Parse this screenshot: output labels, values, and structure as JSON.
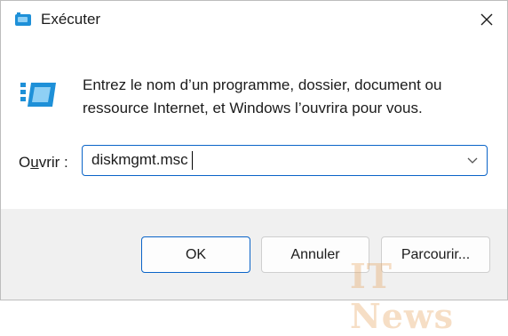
{
  "window": {
    "title": "Exécuter",
    "title_icon": "run-dialog-icon",
    "close_icon": "close-icon"
  },
  "content": {
    "message_line1": "Entrez le nom d’un programme, dossier, document ou",
    "message_line2": "ressource Internet, et Windows l’ouvrira pour vous.",
    "icon": "run-dialog-icon"
  },
  "open_field": {
    "label_prefix": "O",
    "label_underlined": "u",
    "label_suffix": "vrir :",
    "value": "diskmgmt.msc",
    "dropdown_icon": "chevron-down-icon"
  },
  "buttons": {
    "ok": "OK",
    "cancel": "Annuler",
    "browse": "Parcourir..."
  },
  "watermark": "IT News",
  "colors": {
    "accent": "#0a64c8",
    "icon_blue": "#1e90d8",
    "icon_light": "#8fd0f5",
    "footer_bg": "#f0f0f0"
  }
}
